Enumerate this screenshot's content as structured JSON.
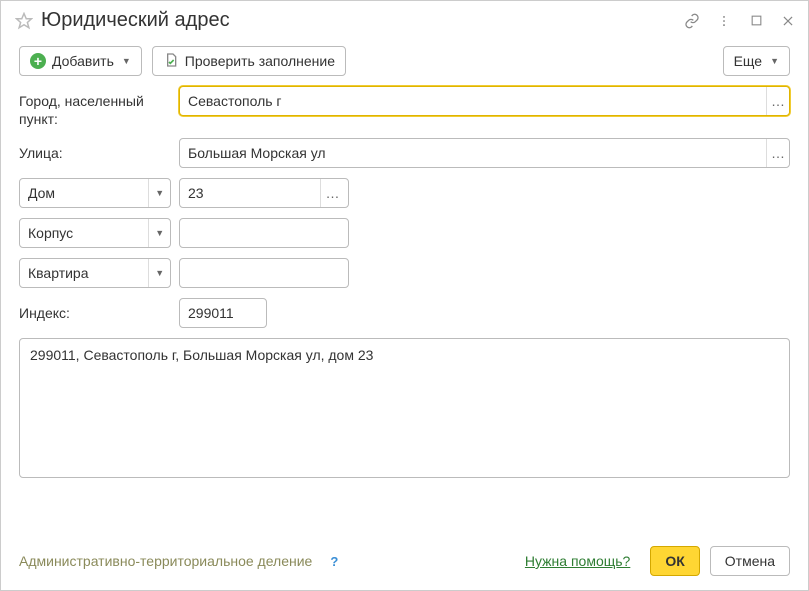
{
  "title": "Юридический адрес",
  "toolbar": {
    "add_label": "Добавить",
    "check_label": "Проверить заполнение",
    "more_label": "Еще"
  },
  "labels": {
    "city": "Город, населенный пункт:",
    "street": "Улица:",
    "house_type": "Дом",
    "building_type": "Корпус",
    "flat_type": "Квартира",
    "index": "Индекс:"
  },
  "values": {
    "city": "Севастополь г",
    "street": "Большая Морская ул",
    "house": "23",
    "building": "",
    "flat": "",
    "index": "299011",
    "full_address": "299011, Севастополь г, Большая Морская ул, дом 23"
  },
  "footer": {
    "admin_division": "Административно-территориальное деление",
    "need_help": "Нужна помощь?",
    "ok": "ОК",
    "cancel": "Отмена"
  }
}
